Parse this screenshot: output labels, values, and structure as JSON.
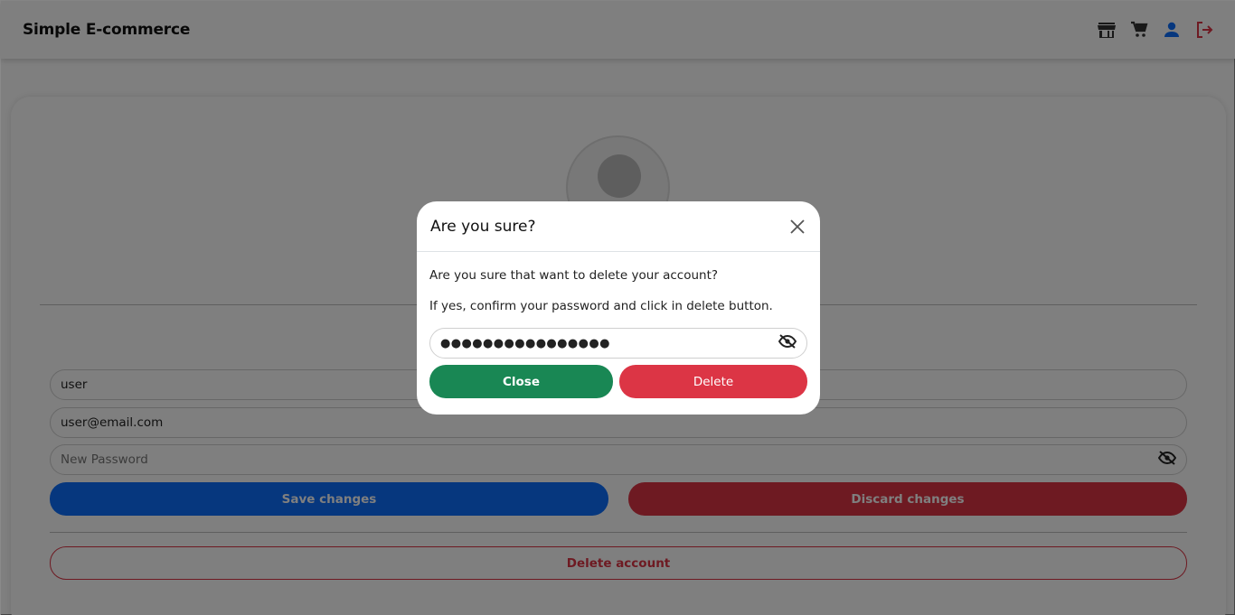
{
  "header": {
    "brand": "Simple E-commerce",
    "icons": [
      "store-icon",
      "cart-icon",
      "user-icon",
      "logout-icon"
    ],
    "logout_color": "#dc3545",
    "user_color": "#0d6efd"
  },
  "profile": {
    "username": "user",
    "email": "user@email.com",
    "new_password_placeholder": "New Password",
    "save_label": "Save changes",
    "discard_label": "Discard changes",
    "delete_account_label": "Delete account"
  },
  "modal": {
    "title": "Are you sure?",
    "message1": "Are you sure that want to delete your account?",
    "message2": "If yes, confirm your password and click in delete button.",
    "password_masked": "●●●●●●●●●●●●●●●●",
    "close_label": "Close",
    "delete_label": "Delete"
  },
  "colors": {
    "primary": "#0d6efd",
    "danger": "#dc3545",
    "success": "#198754"
  }
}
